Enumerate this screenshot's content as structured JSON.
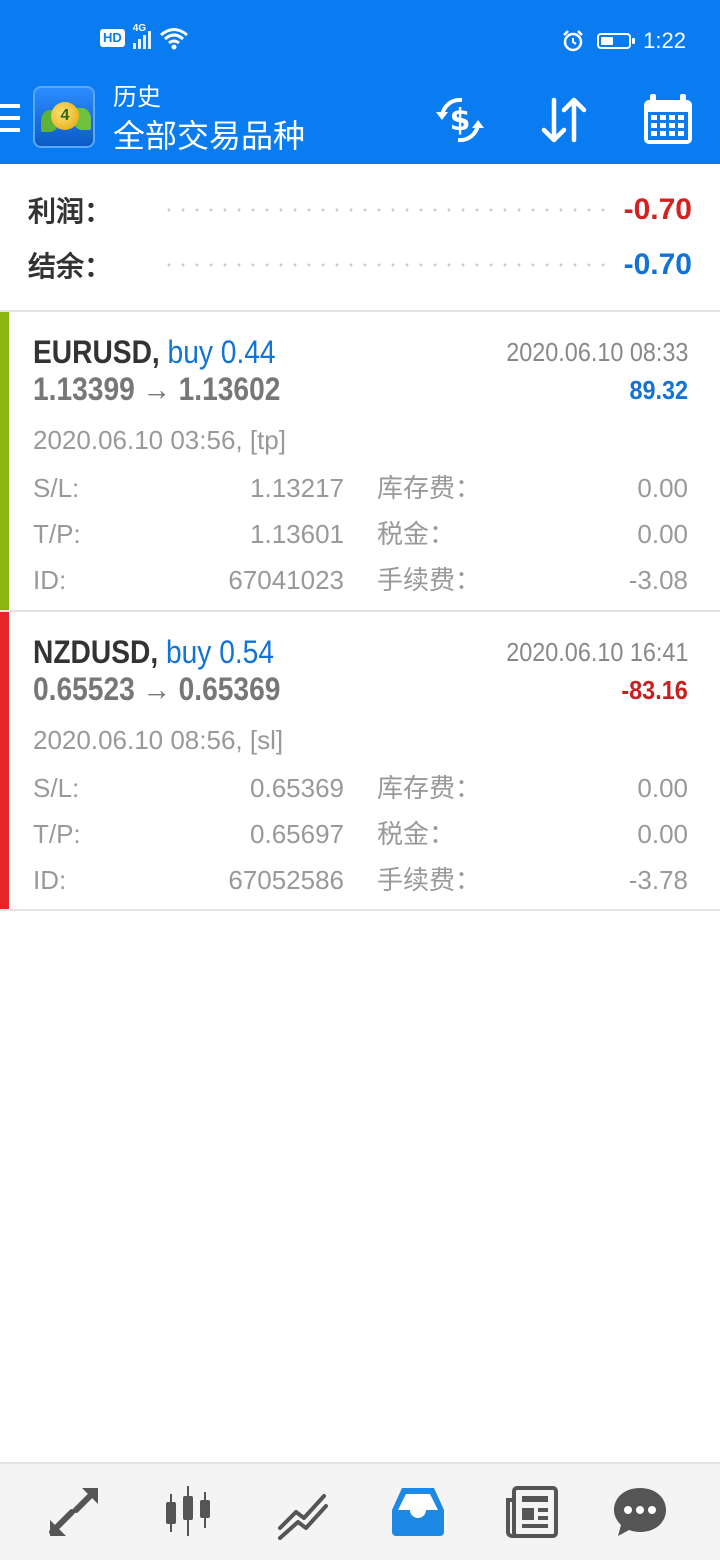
{
  "status_bar": {
    "hd": "HD",
    "network": "4G",
    "time": "1:22",
    "icons": [
      "signal-icon",
      "wifi-icon",
      "alarm-icon",
      "battery-icon"
    ]
  },
  "app_bar": {
    "subtitle": "历史",
    "title": "全部交易品种",
    "icons": [
      "menu-icon",
      "metatrader4-logo",
      "currency-exchange-icon",
      "sort-icon",
      "calendar-icon"
    ]
  },
  "summary": {
    "profit_label": "利润：",
    "profit_value": "-0.70",
    "balance_label": "结余：",
    "balance_value": "-0.70"
  },
  "trades": [
    {
      "symbol": "EURUSD,",
      "side": "buy 0.44",
      "close_time": "2020.06.10 08:33",
      "prices": "1.13399 → 1.13602",
      "profit": "89.32",
      "open_info": "2020.06.10 03:56, [tp]",
      "sl_label": "S/L:",
      "sl_value": "1.13217",
      "swap_label": "库存费：",
      "swap_value": "0.00",
      "tp_label": "T/P:",
      "tp_value": "1.13601",
      "tax_label": "税金：",
      "tax_value": "0.00",
      "id_label": "ID:",
      "id_value": "67041023",
      "commission_label": "手续费：",
      "commission_value": "-3.08"
    },
    {
      "symbol": "NZDUSD,",
      "side": "buy 0.54",
      "close_time": "2020.06.10 16:41",
      "prices": "0.65523 → 0.65369",
      "profit": "-83.16",
      "open_info": "2020.06.10 08:56, [sl]",
      "sl_label": "S/L:",
      "sl_value": "0.65369",
      "swap_label": "库存费：",
      "swap_value": "0.00",
      "tp_label": "T/P:",
      "tp_value": "0.65697",
      "tax_label": "税金：",
      "tax_value": "0.00",
      "id_label": "ID:",
      "id_value": "67052586",
      "commission_label": "手续费：",
      "commission_value": "-3.78"
    }
  ],
  "bottom_nav": {
    "items": [
      "quotes-icon",
      "chart-candles-icon",
      "trade-icon",
      "history-inbox-icon",
      "news-icon",
      "chat-icon"
    ],
    "active": "history-inbox-icon"
  },
  "colors": {
    "primary": "#0a7cf2",
    "profit_negative": "#d32222",
    "profit_positive": "#1273d6",
    "stripe_win": "#8bb510",
    "stripe_loss": "#e42626",
    "icon_gray": "#555555",
    "nav_active": "#1e88e5"
  }
}
